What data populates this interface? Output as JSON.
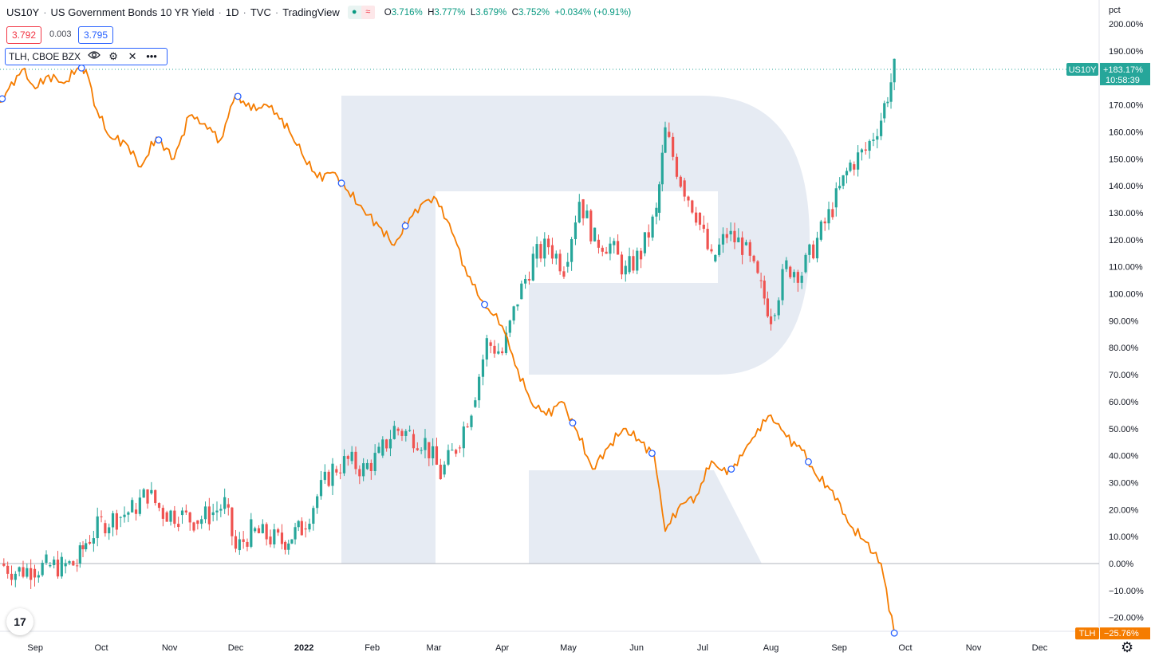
{
  "header": {
    "symbol": "US10Y",
    "name": "US Government Bonds 10 YR Yield",
    "interval": "1D",
    "exchange": "TVC",
    "source": "TradingView",
    "ohlc": {
      "o_label": "O",
      "o": "3.716%",
      "h_label": "H",
      "h": "3.777%",
      "l_label": "L",
      "l": "3.679%",
      "c_label": "C",
      "c": "3.752%",
      "change": "+0.034% (+0.91%)"
    }
  },
  "trade": {
    "bid": "3.792",
    "spread": "0.003",
    "ask": "3.795"
  },
  "overlay_legend": {
    "label": "TLH, CBOE BZX",
    "icons": [
      "eye-icon",
      "gear-icon",
      "close-icon",
      "more-icon"
    ]
  },
  "axis_unit": "pct",
  "logo_text": "17",
  "chart_data": {
    "type": "line",
    "y_scale": "percent-change",
    "ylim": [
      -20,
      200
    ],
    "y_ticks": [
      -20,
      -10,
      0,
      10,
      20,
      30,
      40,
      50,
      60,
      70,
      80,
      90,
      100,
      110,
      120,
      130,
      140,
      150,
      160,
      170,
      180,
      190,
      200
    ],
    "y_tick_labels": [
      "−20.00%",
      "−10.00%",
      "0.00%",
      "10.00%",
      "20.00%",
      "30.00%",
      "40.00%",
      "50.00%",
      "60.00%",
      "70.00%",
      "80.00%",
      "90.00%",
      "100.00%",
      "110.00%",
      "120.00%",
      "130.00%",
      "140.00%",
      "150.00%",
      "160.00%",
      "170.00%",
      "180.00%",
      "190.00%",
      "200.00%"
    ],
    "x_domain": [
      "2021-08-16",
      "2022-12-28"
    ],
    "x_ticks": [
      {
        "label": "Sep",
        "date": "2021-09-01",
        "bold": false
      },
      {
        "label": "Oct",
        "date": "2021-10-01",
        "bold": false
      },
      {
        "label": "Nov",
        "date": "2021-11-01",
        "bold": false
      },
      {
        "label": "Dec",
        "date": "2021-12-01",
        "bold": false
      },
      {
        "label": "2022",
        "date": "2022-01-01",
        "bold": true
      },
      {
        "label": "Feb",
        "date": "2022-02-01",
        "bold": false
      },
      {
        "label": "Mar",
        "date": "2022-03-01",
        "bold": false
      },
      {
        "label": "Apr",
        "date": "2022-04-01",
        "bold": false
      },
      {
        "label": "May",
        "date": "2022-05-01",
        "bold": false
      },
      {
        "label": "Jun",
        "date": "2022-06-01",
        "bold": false
      },
      {
        "label": "Jul",
        "date": "2022-07-01",
        "bold": false
      },
      {
        "label": "Aug",
        "date": "2022-08-01",
        "bold": false
      },
      {
        "label": "Sep",
        "date": "2022-09-01",
        "bold": false
      },
      {
        "label": "Oct",
        "date": "2022-10-01",
        "bold": false
      },
      {
        "label": "Nov",
        "date": "2022-11-01",
        "bold": false
      },
      {
        "label": "Dec",
        "date": "2022-12-01",
        "bold": false
      }
    ],
    "series": [
      {
        "name": "US10Y",
        "style": "candles",
        "up_color": "#26a69a",
        "down_color": "#ef5350",
        "last_label": "+183.17%",
        "countdown": "10:58:39",
        "label_color": "#26a69a",
        "points": [
          [
            "2021-08-16",
            0
          ],
          [
            "2021-08-23",
            -3
          ],
          [
            "2021-08-30",
            -2
          ],
          [
            "2021-09-06",
            -1
          ],
          [
            "2021-09-13",
            -1
          ],
          [
            "2021-09-20",
            0
          ],
          [
            "2021-09-24",
            8
          ],
          [
            "2021-10-01",
            15
          ],
          [
            "2021-10-08",
            17
          ],
          [
            "2021-10-15",
            20
          ],
          [
            "2021-10-22",
            26
          ],
          [
            "2021-10-29",
            19
          ],
          [
            "2021-11-05",
            18
          ],
          [
            "2021-11-12",
            16
          ],
          [
            "2021-11-19",
            18
          ],
          [
            "2021-11-26",
            22
          ],
          [
            "2021-12-01",
            5
          ],
          [
            "2021-12-08",
            12
          ],
          [
            "2021-12-15",
            10
          ],
          [
            "2021-12-22",
            8
          ],
          [
            "2021-12-31",
            13
          ],
          [
            "2022-01-07",
            25
          ],
          [
            "2022-01-14",
            35
          ],
          [
            "2022-01-21",
            38
          ],
          [
            "2022-01-28",
            35
          ],
          [
            "2022-02-04",
            40
          ],
          [
            "2022-02-11",
            50
          ],
          [
            "2022-02-18",
            48
          ],
          [
            "2022-02-25",
            45
          ],
          [
            "2022-03-04",
            33
          ],
          [
            "2022-03-11",
            43
          ],
          [
            "2022-03-18",
            58
          ],
          [
            "2022-03-25",
            82
          ],
          [
            "2022-04-01",
            78
          ],
          [
            "2022-04-08",
            98
          ],
          [
            "2022-04-15",
            113
          ],
          [
            "2022-04-22",
            118
          ],
          [
            "2022-04-29",
            110
          ],
          [
            "2022-05-06",
            135
          ],
          [
            "2022-05-13",
            120
          ],
          [
            "2022-05-20",
            118
          ],
          [
            "2022-05-27",
            108
          ],
          [
            "2022-06-03",
            115
          ],
          [
            "2022-06-10",
            130
          ],
          [
            "2022-06-14",
            160
          ],
          [
            "2022-06-21",
            142
          ],
          [
            "2022-06-28",
            130
          ],
          [
            "2022-07-05",
            112
          ],
          [
            "2022-07-12",
            122
          ],
          [
            "2022-07-19",
            118
          ],
          [
            "2022-07-26",
            105
          ],
          [
            "2022-08-01",
            92
          ],
          [
            "2022-08-08",
            110
          ],
          [
            "2022-08-15",
            108
          ],
          [
            "2022-08-22",
            120
          ],
          [
            "2022-08-29",
            132
          ],
          [
            "2022-09-06",
            148
          ],
          [
            "2022-09-13",
            153
          ],
          [
            "2022-09-20",
            165
          ],
          [
            "2022-09-26",
            183.17
          ]
        ]
      },
      {
        "name": "TLH",
        "style": "line",
        "color": "#f57c00",
        "last_label": "−25.76%",
        "label_color": "#f57c00",
        "points": [
          [
            "2021-08-16",
            171
          ],
          [
            "2021-08-20",
            176
          ],
          [
            "2021-08-26",
            183
          ],
          [
            "2021-09-01",
            176
          ],
          [
            "2021-09-07",
            181
          ],
          [
            "2021-09-14",
            178
          ],
          [
            "2021-09-21",
            184
          ],
          [
            "2021-09-24",
            183
          ],
          [
            "2021-09-29",
            168
          ],
          [
            "2021-10-05",
            158
          ],
          [
            "2021-10-12",
            156
          ],
          [
            "2021-10-19",
            147
          ],
          [
            "2021-10-26",
            158
          ],
          [
            "2021-11-03",
            150
          ],
          [
            "2021-11-10",
            166
          ],
          [
            "2021-11-17",
            163
          ],
          [
            "2021-11-24",
            157
          ],
          [
            "2021-12-01",
            174
          ],
          [
            "2021-12-08",
            168
          ],
          [
            "2021-12-15",
            170
          ],
          [
            "2021-12-22",
            165
          ],
          [
            "2021-12-31",
            152
          ],
          [
            "2022-01-07",
            143
          ],
          [
            "2022-01-14",
            145
          ],
          [
            "2022-01-21",
            138
          ],
          [
            "2022-01-28",
            131
          ],
          [
            "2022-02-04",
            125
          ],
          [
            "2022-02-11",
            118
          ],
          [
            "2022-02-18",
            128
          ],
          [
            "2022-02-23",
            133
          ],
          [
            "2022-03-01",
            136
          ],
          [
            "2022-03-08",
            126
          ],
          [
            "2022-03-15",
            110
          ],
          [
            "2022-03-22",
            98
          ],
          [
            "2022-03-28",
            92
          ],
          [
            "2022-04-01",
            88
          ],
          [
            "2022-04-08",
            72
          ],
          [
            "2022-04-14",
            60
          ],
          [
            "2022-04-21",
            55
          ],
          [
            "2022-04-28",
            60
          ],
          [
            "2022-05-05",
            49
          ],
          [
            "2022-05-12",
            35
          ],
          [
            "2022-05-19",
            43
          ],
          [
            "2022-05-26",
            50
          ],
          [
            "2022-06-02",
            46
          ],
          [
            "2022-06-09",
            40
          ],
          [
            "2022-06-14",
            12
          ],
          [
            "2022-06-21",
            22
          ],
          [
            "2022-06-28",
            25
          ],
          [
            "2022-07-05",
            38
          ],
          [
            "2022-07-12",
            33
          ],
          [
            "2022-07-19",
            40
          ],
          [
            "2022-07-26",
            50
          ],
          [
            "2022-08-01",
            55
          ],
          [
            "2022-08-08",
            47
          ],
          [
            "2022-08-15",
            42
          ],
          [
            "2022-08-22",
            32
          ],
          [
            "2022-08-29",
            27
          ],
          [
            "2022-09-06",
            14
          ],
          [
            "2022-09-13",
            8
          ],
          [
            "2022-09-20",
            0
          ],
          [
            "2022-09-26",
            -25.76
          ]
        ],
        "markers": [
          "2021-08-17",
          "2021-09-22",
          "2021-10-27",
          "2021-12-02",
          "2022-01-18",
          "2022-02-16",
          "2022-03-24",
          "2022-05-03",
          "2022-06-08",
          "2022-07-14",
          "2022-08-18",
          "2022-09-26"
        ]
      }
    ],
    "watermark": "R",
    "grid": false,
    "zero_line": true
  }
}
